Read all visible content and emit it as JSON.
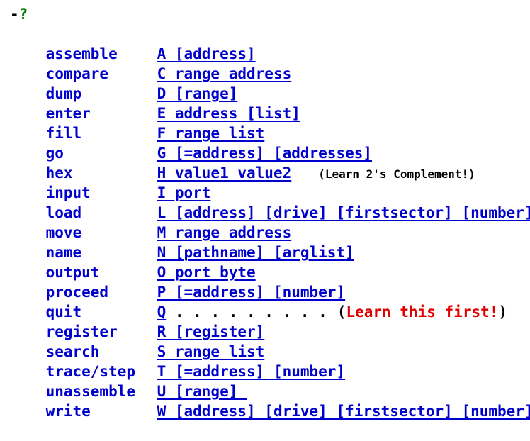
{
  "prompt": {
    "dash": "-",
    "question": "?"
  },
  "commands": [
    {
      "name": "assemble",
      "syntax": "A [address]"
    },
    {
      "name": "compare",
      "syntax": "C range address"
    },
    {
      "name": "dump",
      "syntax": "D [range]"
    },
    {
      "name": "enter",
      "syntax": "E address [list]"
    },
    {
      "name": "fill",
      "syntax": "F range list"
    },
    {
      "name": "go",
      "syntax": "G [=address] [addresses]"
    },
    {
      "name": "hex",
      "syntax": "H value1 value2",
      "note": "(Learn 2's Complement!)"
    },
    {
      "name": "input",
      "syntax": "I port"
    },
    {
      "name": "load",
      "syntax": "L [address] [drive] [firstsector] [number]"
    },
    {
      "name": "move",
      "syntax": "M range address"
    },
    {
      "name": "name",
      "syntax": "N [pathname] [arglist]"
    },
    {
      "name": "output",
      "syntax": "O port byte"
    },
    {
      "name": "proceed",
      "syntax": "P [=address] [number]"
    },
    {
      "name": "quit",
      "syntax": "Q",
      "dots": " . . . . . . . . .",
      "note_open": "(",
      "note_red": "Learn this first!",
      "note_close": ")"
    },
    {
      "name": "register",
      "syntax": "R [register]"
    },
    {
      "name": "search",
      "syntax": "S range list"
    },
    {
      "name": "trace/step",
      "syntax": "T [=address] [number]"
    },
    {
      "name": "unassemble",
      "syntax": "U [range] "
    },
    {
      "name": "write",
      "syntax": "W [address] [drive] [firstsector] [number]"
    }
  ]
}
